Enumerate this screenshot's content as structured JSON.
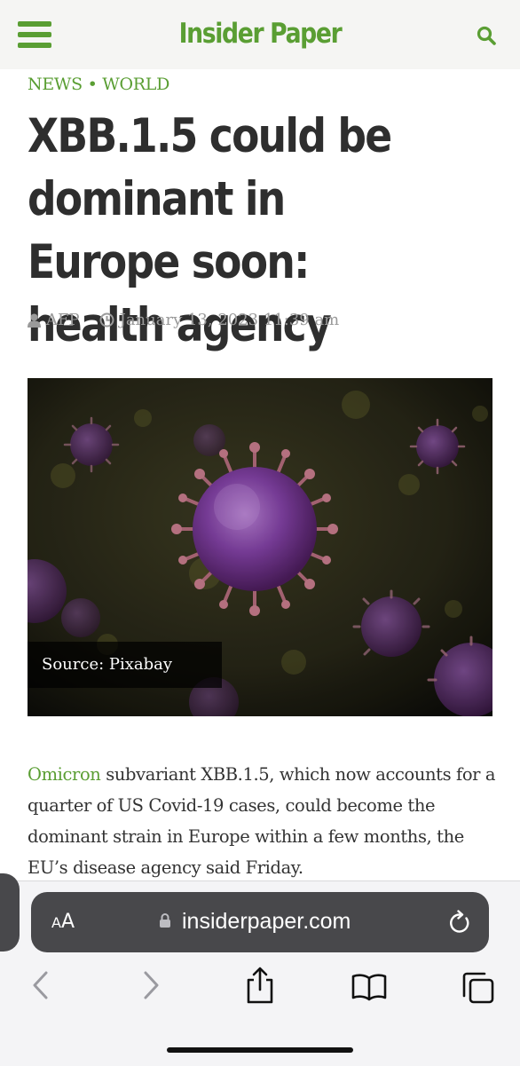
{
  "header": {
    "site_title": "Insider Paper",
    "menu_icon": "hamburger-menu-icon",
    "search_icon": "search-icon"
  },
  "article": {
    "breadcrumb": [
      "NEWS",
      "WORLD"
    ],
    "breadcrumb_separator": "•",
    "headline": "XBB.1.5 could be dominant in Europe soon: health agency",
    "author": "AFP",
    "date": "January 13, 2023 11:39 am",
    "image_caption": "Source: Pixabay",
    "body_link": "Omicron",
    "body_text": " subvariant XBB.1.5, which now accounts for a quarter of US Covid-19 cases, could become the dominant strain in Europe within a few months, the EU’s disease agency said Friday."
  },
  "browser": {
    "aa_small": "A",
    "aa_big": "A",
    "url": "insiderpaper.com",
    "toolbar": [
      "back-icon",
      "forward-icon",
      "share-icon",
      "bookmarks-icon",
      "tabs-icon"
    ]
  },
  "colors": {
    "brand_green": "#5a9e33",
    "headline": "#2e2e2e",
    "meta_gray": "#9a9a9a",
    "address_bar": "#48484b"
  }
}
